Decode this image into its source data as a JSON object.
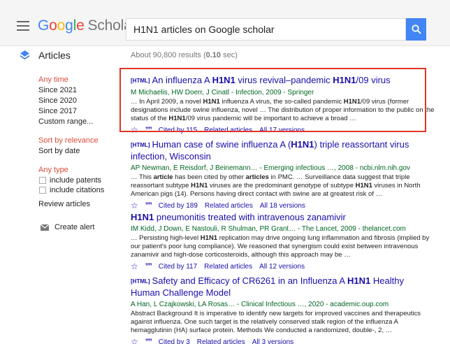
{
  "header": {
    "logo_google": "Google",
    "logo_scholar": "Scholar",
    "search_value": "H1N1 articles on Google scholar"
  },
  "subheader": {
    "articles_label": "Articles",
    "results_count": "About 90,800 results (",
    "results_time": "0.10",
    "results_suffix": " sec)"
  },
  "sidebar": {
    "time_selected": "Any time",
    "time_options": [
      "Since 2021",
      "Since 2020",
      "Since 2017",
      "Custom range..."
    ],
    "sort_selected": "Sort by relevance",
    "sort_date": "Sort by date",
    "type_selected": "Any type",
    "include_patents": "include patents",
    "include_citations": "include citations",
    "review_articles": "Review articles",
    "create_alert": "Create alert"
  },
  "results": [
    {
      "tag": "[HTML]",
      "title_parts": [
        "An influenza A ",
        "H1N1",
        " virus revival–pandemic ",
        "H1N1",
        "/09 virus"
      ],
      "authors": "M Michaelis, HW Doerr, J Cinatl - Infection, 2009 - Springer",
      "snippet_parts": [
        "… In April 2009, a novel ",
        "H1N1",
        " influenza A virus, the so-called pandemic ",
        "H1N1",
        "/09 virus (former designations include swine influenza, novel … The distribution of proper information to the public on the status of the ",
        "H1N1",
        "/09 virus pandemic will be important to achieve a broad …"
      ],
      "cited_by": "Cited by 115",
      "related": "Related articles",
      "versions": "All 17 versions"
    },
    {
      "tag": "[HTML]",
      "title_parts": [
        "Human case of swine influenza A (",
        "H1N1",
        ") triple reassortant virus infection, Wisconsin"
      ],
      "authors": "AP Newman, E Reisdorf, J Beinemann… - Emerging infectious …, 2008 - ncbi.nlm.nih.gov",
      "snippet_parts": [
        "… This ",
        "article",
        " has been cited by other ",
        "articles",
        " in PMC. … Surveillance data suggest that triple reassortant subtype ",
        "H1N1",
        " viruses are the predominant genotype of subtype ",
        "H1N1",
        " viruses in North American pigs (14). Persons having direct contact with swine are at greatest risk of …"
      ],
      "cited_by": "Cited by 189",
      "related": "Related articles",
      "versions": "All 18 versions"
    },
    {
      "tag": "",
      "title_parts": [
        "",
        "H1N1",
        " pneumonitis treated with intravenous zanamivir"
      ],
      "authors": "IM Kidd, J Down, E Nastouli, R Shulman, PR Grant… - The Lancet, 2009 - thelancet.com",
      "snippet_parts": [
        "… Persisting high-level ",
        "H1N1",
        " replication may drive ongoing lung inflammation and fibrosis (implied by our patient's poor lung compliance). We reasoned that synergism could exist between intravenous zanamivir and high-dose corticosteroids, although this approach may be …"
      ],
      "cited_by": "Cited by 117",
      "related": "Related articles",
      "versions": "All 12 versions"
    },
    {
      "tag": "[HTML]",
      "title_parts": [
        "Safety and Efficacy of CR6261 in an Influenza A ",
        "H1N1",
        " Healthy Human Challenge Model"
      ],
      "authors": "A Han, L Czajkowski, LA Rosas… - Clinical Infectious …, 2020 - academic.oup.com",
      "snippet_parts": [
        "Abstract Background It is imperative to identify new targets for improved vaccines and therapeutics against influenza. One such target is the relatively conserved stalk region of the influenza A hemagglutinin (HA) surface protein. Methods We conducted a randomized, double-, 2, …"
      ],
      "cited_by": "Cited by 3",
      "related": "Related articles",
      "versions": "All 3 versions"
    }
  ],
  "colors": {
    "accent_blue": "#4285f4",
    "link_blue": "#1a0dab",
    "author_green": "#006621",
    "selected_red": "#dd4b39",
    "highlight_red": "#e03526"
  },
  "icons": {
    "menu": "hamburger-menu-icon",
    "search": "search-icon",
    "articles": "articles-icon",
    "star": "star-icon",
    "cite": "cite-quote-icon",
    "alert": "mail-icon"
  }
}
